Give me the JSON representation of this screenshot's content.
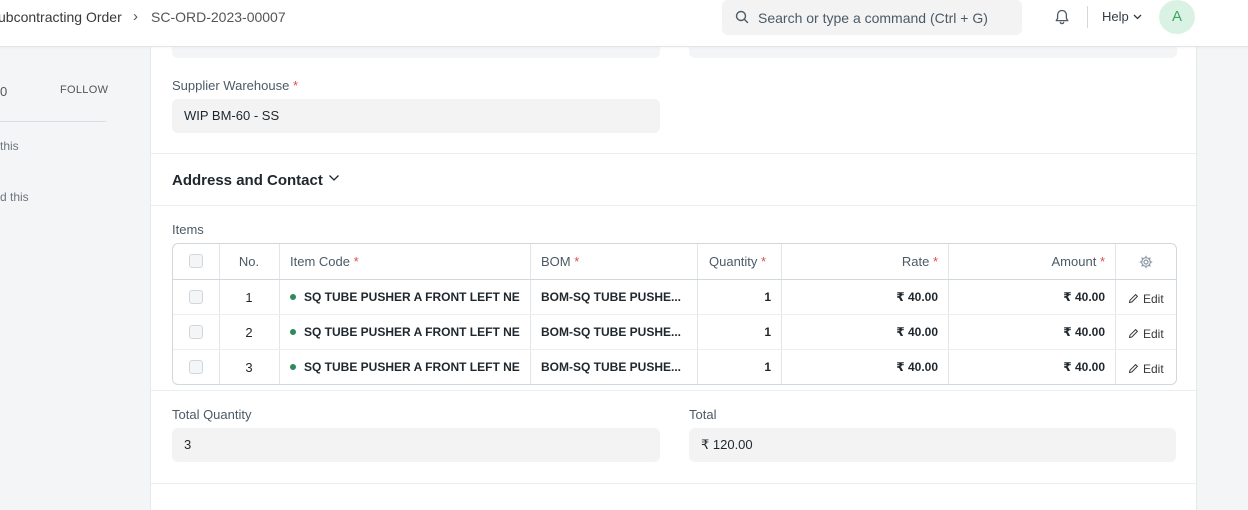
{
  "navbar": {
    "breadcrumb_parent": "ubcontracting Order",
    "breadcrumb_sep": "›",
    "breadcrumb_current": "SC-ORD-2023-00007",
    "search_placeholder": "Search or type a command (Ctrl + G)",
    "help_label": "Help",
    "avatar_initial": "A"
  },
  "sidebar": {
    "count": "0",
    "follow_label": "FOLLOW",
    "line1": "this",
    "line2": "d this"
  },
  "form": {
    "supplier_warehouse_label": "Supplier Warehouse",
    "required_mark": "*",
    "supplier_warehouse_value": "WIP BM-60 - SS",
    "address_section_title": "Address and Contact",
    "items_label": "Items",
    "total_quantity_label": "Total Quantity",
    "total_quantity_value": "3",
    "total_label": "Total",
    "total_value": "₹ 120.00"
  },
  "items_table": {
    "headers": {
      "no": "No.",
      "item_code": "Item Code",
      "bom": "BOM",
      "quantity": "Quantity",
      "rate": "Rate",
      "amount": "Amount"
    },
    "rows": [
      {
        "no": "1",
        "item_code": "SQ TUBE PUSHER A FRONT LEFT NEW",
        "bom": "BOM-SQ TUBE PUSHE...",
        "quantity": "1",
        "rate": "₹ 40.00",
        "amount": "₹ 40.00",
        "action": "Edit"
      },
      {
        "no": "2",
        "item_code": "SQ TUBE PUSHER A FRONT LEFT NEW",
        "bom": "BOM-SQ TUBE PUSHE...",
        "quantity": "1",
        "rate": "₹ 40.00",
        "amount": "₹ 40.00",
        "action": "Edit"
      },
      {
        "no": "3",
        "item_code": "SQ TUBE PUSHER A FRONT LEFT NEW",
        "bom": "BOM-SQ TUBE PUSHE...",
        "quantity": "1",
        "rate": "₹ 40.00",
        "amount": "₹ 40.00",
        "action": "Edit"
      }
    ]
  },
  "colors": {
    "required": "#e24c4c",
    "item_dot": "#2e8a5a",
    "avatar_bg": "#d9f2e4",
    "avatar_fg": "#3ea55f"
  }
}
